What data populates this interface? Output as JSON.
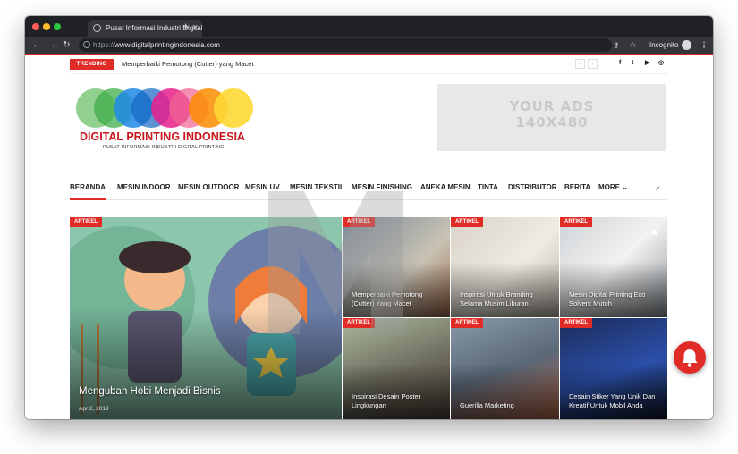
{
  "browser": {
    "tab_title": "Pusat Informasi Industri Digital",
    "url_scheme": "https://",
    "url_host": "www.digitalprintingindonesia.com",
    "incognito_label": "Incognito"
  },
  "topbar": {
    "trending_label": "TRENDING",
    "trending_text": "Memperbaiki Pemotong (Cutter) yang Macet"
  },
  "header": {
    "logo_title": "DIGITAL PRINTING INDONESIA",
    "logo_subtitle": "PUSAT INFORMASI INDUSTRI DIGITAL PRINTING",
    "ad_line1": "YOUR ADS",
    "ad_line2": "140X480"
  },
  "nav": {
    "items": [
      "BERANDA",
      "MESIN INDOOR",
      "MESIN OUTDOOR",
      "MESIN UV",
      "MESIN TEKSTIL",
      "MESIN FINISHING",
      "ANEKA MESIN",
      "TINTA",
      "DISTRIBUTOR",
      "BERITA",
      "MORE"
    ]
  },
  "featured": {
    "badge": "ARTIKEL",
    "title": "Mengubah Hobi Menjadi Bisnis",
    "date": "Apr 2, 2019"
  },
  "posts": [
    {
      "badge": "ARTIKEL",
      "title": "Memperbaiki Pemotong (Cutter) Yang Macet"
    },
    {
      "badge": "ARTIKEL",
      "title": "Inspirasi Untuk Branding Selama Musim Liburan"
    },
    {
      "badge": "ARTIKEL",
      "title": "Mesin Digital Printing Eco Solvent Mutoh"
    },
    {
      "badge": "ARTIKEL",
      "title": "Inspirasi Desain Poster Lingkungan"
    },
    {
      "badge": "ARTIKEL",
      "title": "Guerilla Marketing"
    },
    {
      "badge": "ARTIKEL",
      "title": "Desain Stiker Yang Unik Dan Kreatif Untuk Mobil Anda"
    }
  ],
  "colors": {
    "accent": "#e02b27",
    "logo_red": "#c8161d"
  }
}
